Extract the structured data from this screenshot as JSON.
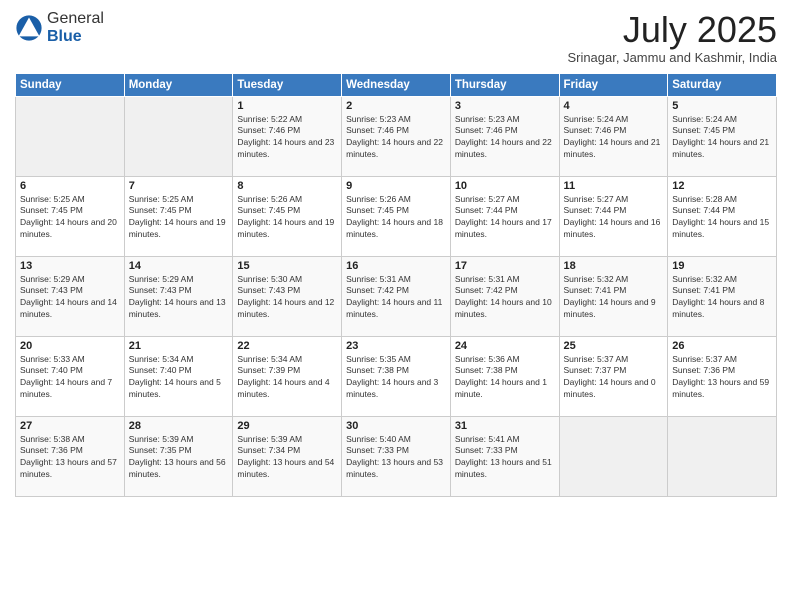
{
  "logo": {
    "general": "General",
    "blue": "Blue"
  },
  "header": {
    "month": "July 2025",
    "location": "Srinagar, Jammu and Kashmir, India"
  },
  "days_of_week": [
    "Sunday",
    "Monday",
    "Tuesday",
    "Wednesday",
    "Thursday",
    "Friday",
    "Saturday"
  ],
  "weeks": [
    [
      {
        "day": "",
        "info": ""
      },
      {
        "day": "",
        "info": ""
      },
      {
        "day": "1",
        "info": "Sunrise: 5:22 AM\nSunset: 7:46 PM\nDaylight: 14 hours and 23 minutes."
      },
      {
        "day": "2",
        "info": "Sunrise: 5:23 AM\nSunset: 7:46 PM\nDaylight: 14 hours and 22 minutes."
      },
      {
        "day": "3",
        "info": "Sunrise: 5:23 AM\nSunset: 7:46 PM\nDaylight: 14 hours and 22 minutes."
      },
      {
        "day": "4",
        "info": "Sunrise: 5:24 AM\nSunset: 7:46 PM\nDaylight: 14 hours and 21 minutes."
      },
      {
        "day": "5",
        "info": "Sunrise: 5:24 AM\nSunset: 7:45 PM\nDaylight: 14 hours and 21 minutes."
      }
    ],
    [
      {
        "day": "6",
        "info": "Sunrise: 5:25 AM\nSunset: 7:45 PM\nDaylight: 14 hours and 20 minutes."
      },
      {
        "day": "7",
        "info": "Sunrise: 5:25 AM\nSunset: 7:45 PM\nDaylight: 14 hours and 19 minutes."
      },
      {
        "day": "8",
        "info": "Sunrise: 5:26 AM\nSunset: 7:45 PM\nDaylight: 14 hours and 19 minutes."
      },
      {
        "day": "9",
        "info": "Sunrise: 5:26 AM\nSunset: 7:45 PM\nDaylight: 14 hours and 18 minutes."
      },
      {
        "day": "10",
        "info": "Sunrise: 5:27 AM\nSunset: 7:44 PM\nDaylight: 14 hours and 17 minutes."
      },
      {
        "day": "11",
        "info": "Sunrise: 5:27 AM\nSunset: 7:44 PM\nDaylight: 14 hours and 16 minutes."
      },
      {
        "day": "12",
        "info": "Sunrise: 5:28 AM\nSunset: 7:44 PM\nDaylight: 14 hours and 15 minutes."
      }
    ],
    [
      {
        "day": "13",
        "info": "Sunrise: 5:29 AM\nSunset: 7:43 PM\nDaylight: 14 hours and 14 minutes."
      },
      {
        "day": "14",
        "info": "Sunrise: 5:29 AM\nSunset: 7:43 PM\nDaylight: 14 hours and 13 minutes."
      },
      {
        "day": "15",
        "info": "Sunrise: 5:30 AM\nSunset: 7:43 PM\nDaylight: 14 hours and 12 minutes."
      },
      {
        "day": "16",
        "info": "Sunrise: 5:31 AM\nSunset: 7:42 PM\nDaylight: 14 hours and 11 minutes."
      },
      {
        "day": "17",
        "info": "Sunrise: 5:31 AM\nSunset: 7:42 PM\nDaylight: 14 hours and 10 minutes."
      },
      {
        "day": "18",
        "info": "Sunrise: 5:32 AM\nSunset: 7:41 PM\nDaylight: 14 hours and 9 minutes."
      },
      {
        "day": "19",
        "info": "Sunrise: 5:32 AM\nSunset: 7:41 PM\nDaylight: 14 hours and 8 minutes."
      }
    ],
    [
      {
        "day": "20",
        "info": "Sunrise: 5:33 AM\nSunset: 7:40 PM\nDaylight: 14 hours and 7 minutes."
      },
      {
        "day": "21",
        "info": "Sunrise: 5:34 AM\nSunset: 7:40 PM\nDaylight: 14 hours and 5 minutes."
      },
      {
        "day": "22",
        "info": "Sunrise: 5:34 AM\nSunset: 7:39 PM\nDaylight: 14 hours and 4 minutes."
      },
      {
        "day": "23",
        "info": "Sunrise: 5:35 AM\nSunset: 7:38 PM\nDaylight: 14 hours and 3 minutes."
      },
      {
        "day": "24",
        "info": "Sunrise: 5:36 AM\nSunset: 7:38 PM\nDaylight: 14 hours and 1 minute."
      },
      {
        "day": "25",
        "info": "Sunrise: 5:37 AM\nSunset: 7:37 PM\nDaylight: 14 hours and 0 minutes."
      },
      {
        "day": "26",
        "info": "Sunrise: 5:37 AM\nSunset: 7:36 PM\nDaylight: 13 hours and 59 minutes."
      }
    ],
    [
      {
        "day": "27",
        "info": "Sunrise: 5:38 AM\nSunset: 7:36 PM\nDaylight: 13 hours and 57 minutes."
      },
      {
        "day": "28",
        "info": "Sunrise: 5:39 AM\nSunset: 7:35 PM\nDaylight: 13 hours and 56 minutes."
      },
      {
        "day": "29",
        "info": "Sunrise: 5:39 AM\nSunset: 7:34 PM\nDaylight: 13 hours and 54 minutes."
      },
      {
        "day": "30",
        "info": "Sunrise: 5:40 AM\nSunset: 7:33 PM\nDaylight: 13 hours and 53 minutes."
      },
      {
        "day": "31",
        "info": "Sunrise: 5:41 AM\nSunset: 7:33 PM\nDaylight: 13 hours and 51 minutes."
      },
      {
        "day": "",
        "info": ""
      },
      {
        "day": "",
        "info": ""
      }
    ]
  ]
}
